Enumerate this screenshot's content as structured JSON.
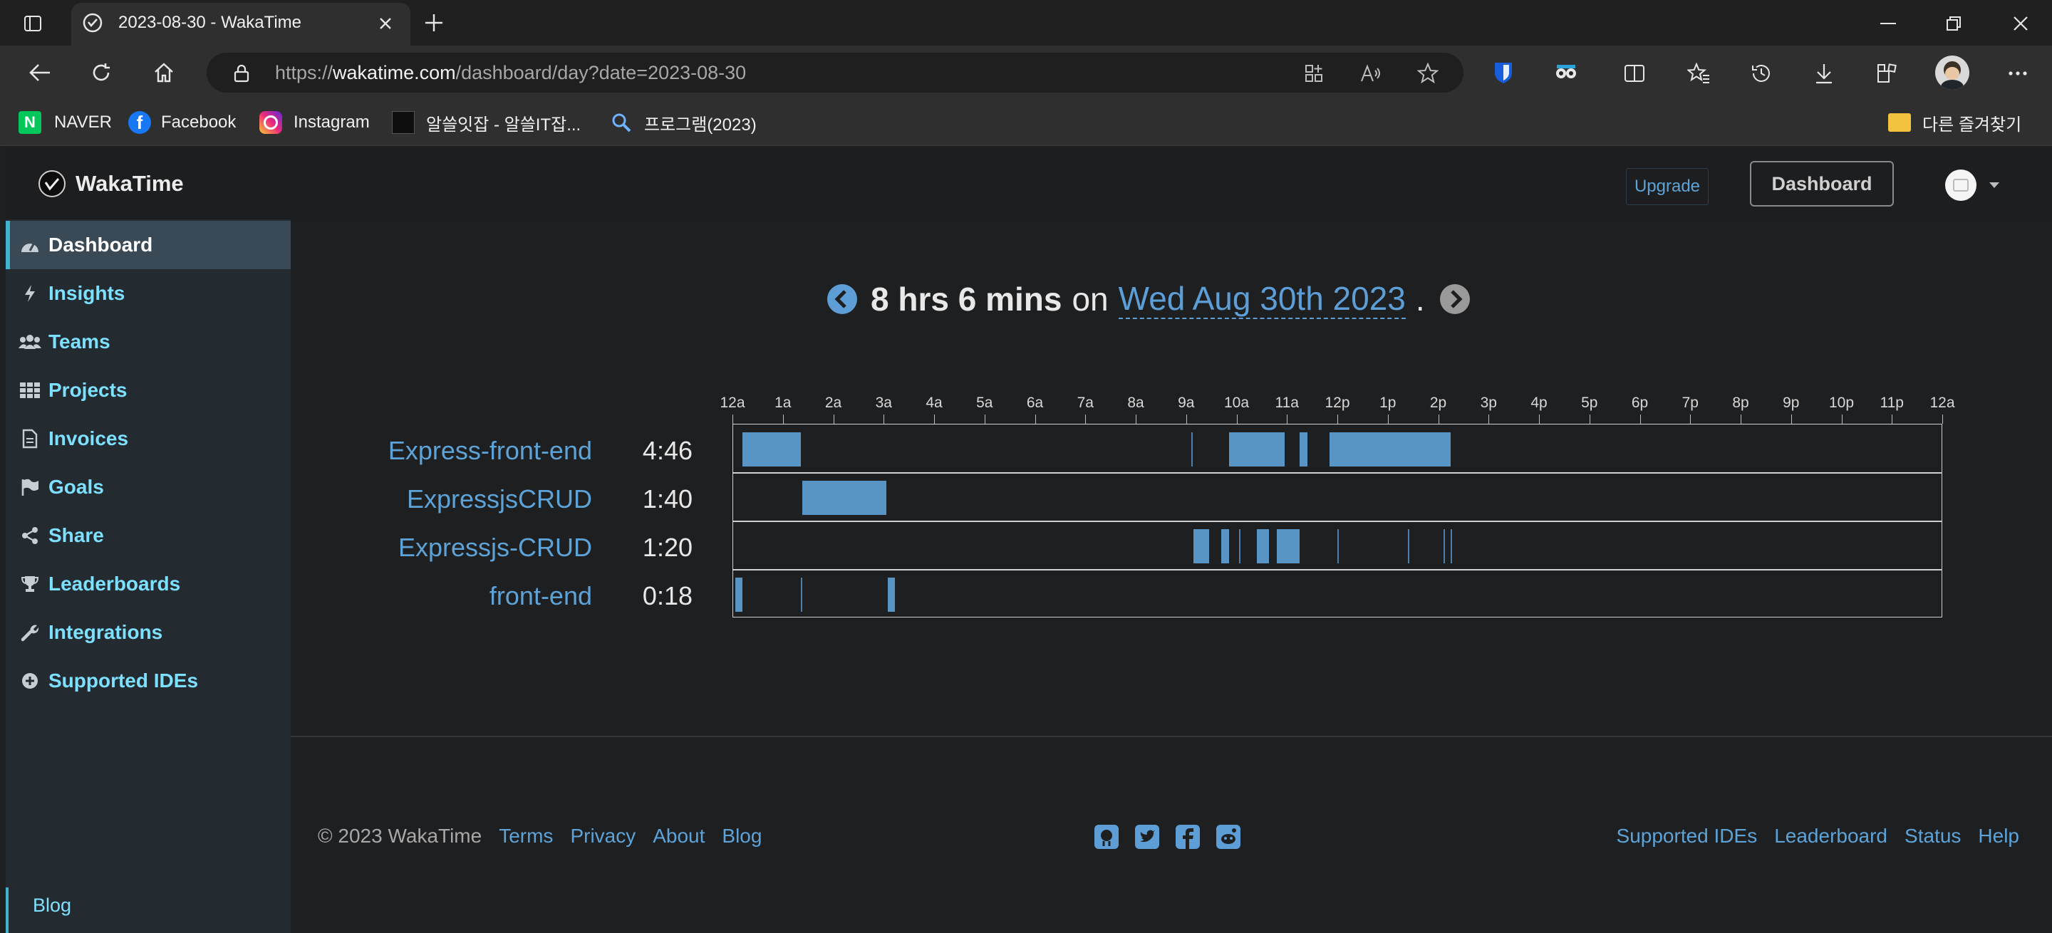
{
  "browser": {
    "tab_title": "2023-08-30 - WakaTime",
    "url_prefix": "https://",
    "url_host": "wakatime.com",
    "url_path": "/dashboard/day?date=2023-08-30",
    "bookmarks": [
      {
        "label": "NAVER",
        "icon": "naver-icon",
        "color": "#03c75a"
      },
      {
        "label": "Facebook",
        "icon": "facebook-icon",
        "color": "#1877f2"
      },
      {
        "label": "Instagram",
        "icon": "instagram-icon",
        "color": "#dd2a7b"
      },
      {
        "label": "알쓸잇잡 - 알쓸IT잡...",
        "icon": "site-icon",
        "color": "#111111"
      },
      {
        "label": "프로그램(2023)",
        "icon": "search-icon",
        "color": "#4a90e2"
      }
    ],
    "other_favorites": "다른 즐겨찾기"
  },
  "header": {
    "logo_text": "WakaTime",
    "upgrade_label": "Upgrade",
    "dashboard_label": "Dashboard"
  },
  "sidebar": {
    "items": [
      {
        "label": "Dashboard",
        "icon": "dashboard-icon",
        "active": true
      },
      {
        "label": "Insights",
        "icon": "bolt-icon"
      },
      {
        "label": "Teams",
        "icon": "users-icon"
      },
      {
        "label": "Projects",
        "icon": "grid-icon"
      },
      {
        "label": "Invoices",
        "icon": "document-icon"
      },
      {
        "label": "Goals",
        "icon": "flag-icon"
      },
      {
        "label": "Share",
        "icon": "share-icon"
      },
      {
        "label": "Leaderboards",
        "icon": "trophy-icon"
      },
      {
        "label": "Integrations",
        "icon": "wrench-icon"
      },
      {
        "label": "Supported IDEs",
        "icon": "plus-circle-icon"
      }
    ],
    "bottom_link": "Blog"
  },
  "summary": {
    "duration": "8 hrs 6 mins",
    "on_word": "on",
    "date": "Wed Aug 30th 2023",
    "period": "."
  },
  "timeline": {
    "hour_labels": [
      "12a",
      "1a",
      "2a",
      "3a",
      "4a",
      "5a",
      "6a",
      "7a",
      "8a",
      "9a",
      "10a",
      "11a",
      "12p",
      "1p",
      "2p",
      "3p",
      "4p",
      "5p",
      "6p",
      "7p",
      "8p",
      "9p",
      "10p",
      "11p",
      "12a"
    ],
    "projects": [
      {
        "name": "Express-front-end",
        "time": "4:46"
      },
      {
        "name": "ExpressjsCRUD",
        "time": "1:40"
      },
      {
        "name": "Expressjs-CRUD",
        "time": "1:20"
      },
      {
        "name": "front-end",
        "time": "0:18"
      }
    ],
    "bar_color": "#5e9ed6"
  },
  "chart_data": {
    "type": "bar",
    "title": "8 hrs 6 mins on Wed Aug 30th 2023",
    "xlabel": "",
    "ylabel": "",
    "x_range": [
      "12a",
      "12a"
    ],
    "series": [
      {
        "name": "Express-front-end",
        "segments_hours": [
          [
            0.2,
            1.35
          ],
          [
            9.1,
            9.12
          ],
          [
            9.85,
            10.95
          ],
          [
            11.25,
            11.4
          ],
          [
            11.85,
            14.25
          ]
        ]
      },
      {
        "name": "ExpressjsCRUD",
        "segments_hours": [
          [
            1.38,
            3.05
          ]
        ]
      },
      {
        "name": "Expressjs-CRUD",
        "segments_hours": [
          [
            9.15,
            9.45
          ],
          [
            9.7,
            9.85
          ],
          [
            10.05,
            10.07
          ],
          [
            10.4,
            10.65
          ],
          [
            10.8,
            11.25
          ],
          [
            12.0,
            12.02
          ],
          [
            13.4,
            13.42
          ],
          [
            14.1,
            14.12
          ],
          [
            14.25,
            14.27
          ]
        ]
      },
      {
        "name": "front-end",
        "segments_hours": [
          [
            0.05,
            0.2
          ],
          [
            1.35,
            1.37
          ],
          [
            3.08,
            3.22
          ]
        ]
      }
    ]
  },
  "footer": {
    "copyright": "© 2023 WakaTime",
    "left_links": [
      "Terms",
      "Privacy",
      "About",
      "Blog"
    ],
    "social_icons": [
      "github-icon",
      "twitter-icon",
      "facebook-icon",
      "reddit-icon"
    ],
    "right_links": [
      "Supported IDEs",
      "Leaderboard",
      "Status",
      "Help"
    ]
  }
}
